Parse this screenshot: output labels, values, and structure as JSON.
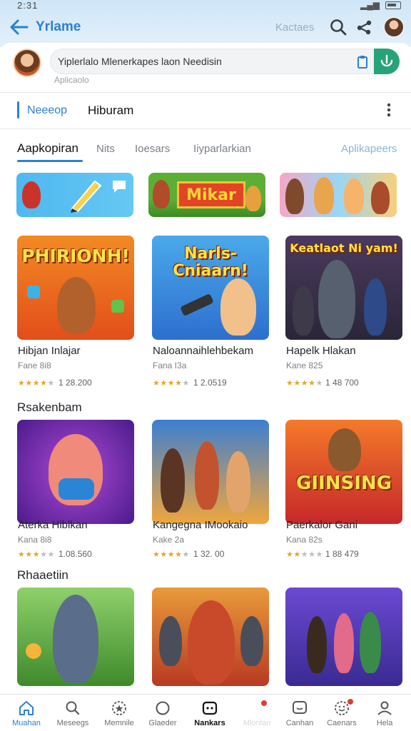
{
  "status_bar": {
    "time": "2:31"
  },
  "header": {
    "title": "Yrlame",
    "link": "Kactaes"
  },
  "search": {
    "value": "Yiplerlalo Mlenerkapes laon Needisin",
    "sublabel": "Aplicaolo"
  },
  "category": {
    "primary": "Neeeop",
    "secondary": "Hiburam"
  },
  "tabs": [
    {
      "label": "Aapkopiran",
      "active": true
    },
    {
      "label": "Nits",
      "active": false
    },
    {
      "label": "Ioesars",
      "active": false
    },
    {
      "label": "Iiyparlarkian",
      "active": false
    }
  ],
  "tabs_link": "Aplikapeers",
  "banners": [
    {
      "name": "banner-edit"
    },
    {
      "name": "banner-mikar",
      "sign": "Mikar"
    },
    {
      "name": "banner-characters"
    }
  ],
  "games_row1": [
    {
      "art_title": "PHIRIONH!",
      "name": "Hibjan Inlajar",
      "sub": "Fane 8i8",
      "rating": 4,
      "count": "1 28.200"
    },
    {
      "art_title": "Narls-Cniaarn!",
      "name": "Naloannaihlehbekam",
      "sub": "Fana I3a",
      "rating": 4,
      "count": "1 2.0519"
    },
    {
      "art_title": "Keatlaot Ni yam!",
      "name": "Hapelk Hlakan",
      "sub": "Kane 825",
      "rating": 4,
      "count": "1 48 700"
    }
  ],
  "section_2": "Rsakenbam",
  "games_row2": [
    {
      "name": "Aterka Hiblkan",
      "sub": "Kana 8i8",
      "rating": 3,
      "count": "1.08.560"
    },
    {
      "name": "Kangegna IMookaio",
      "sub": "Kake 2a",
      "rating": 4,
      "count": "1 32. 00"
    },
    {
      "art_title": "GIINSING",
      "name": "Paerkalor Gani",
      "sub": "Kana 82s",
      "rating": 2,
      "count": "1 88 479"
    }
  ],
  "section_3": "Rhaaetiin",
  "bottom_nav": [
    {
      "label": "Muahan",
      "icon": "home-icon",
      "state": "active"
    },
    {
      "label": "Meseegs",
      "icon": "search-icon",
      "state": ""
    },
    {
      "label": "Memnile",
      "icon": "star-badge-icon",
      "state": ""
    },
    {
      "label": "Glaeder",
      "icon": "circle-icon",
      "state": ""
    },
    {
      "label": "Nankars",
      "icon": "gamepad-icon",
      "state": "bold"
    },
    {
      "label": "Mlonlan",
      "icon": "notification-icon",
      "state": "faded"
    },
    {
      "label": "Canhan",
      "icon": "chat-icon",
      "state": ""
    },
    {
      "label": "Caenars",
      "icon": "smile-badge-icon",
      "state": ""
    },
    {
      "label": "Hela",
      "icon": "person-icon",
      "state": ""
    }
  ],
  "colors": {
    "accent": "#2d7fd0",
    "mic": "#27a37a",
    "star": "#e2a72b"
  }
}
